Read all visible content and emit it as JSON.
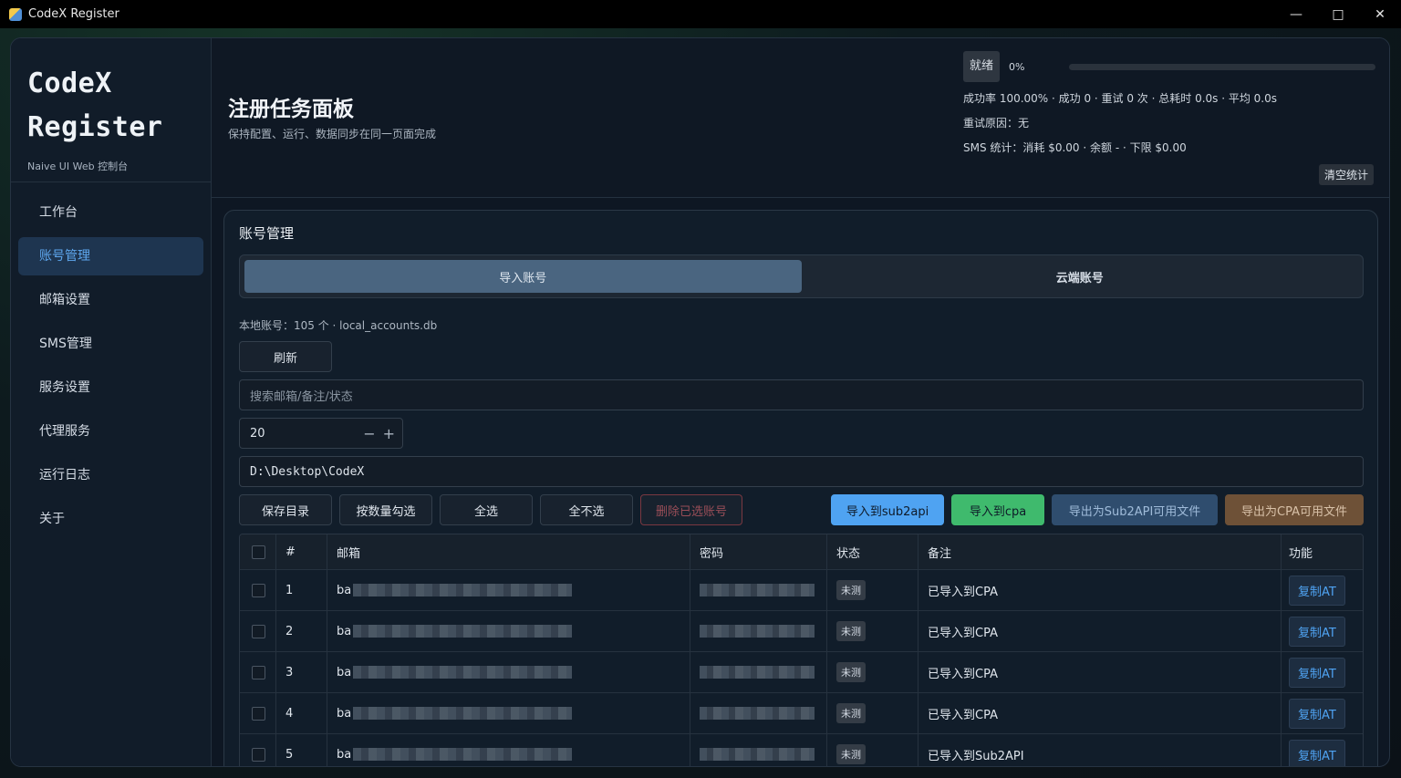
{
  "window": {
    "title": "CodeX Register"
  },
  "sidebar": {
    "brand_line1": "CodeX",
    "brand_line2": "Register",
    "brand_sub": "Naive UI Web 控制台",
    "items": [
      {
        "label": "工作台"
      },
      {
        "label": "账号管理"
      },
      {
        "label": "邮箱设置"
      },
      {
        "label": "SMS管理"
      },
      {
        "label": "服务设置"
      },
      {
        "label": "代理服务"
      },
      {
        "label": "运行日志"
      },
      {
        "label": "关于"
      }
    ]
  },
  "header": {
    "title": "注册任务面板",
    "subtitle": "保持配置、运行、数据同步在同一页面完成",
    "status_label": "就绪",
    "progress_percent": 0,
    "progress_text": "0%",
    "stats_line": "成功率 100.00% · 成功 0 · 重试 0 次 · 总耗时 0.0s · 平均 0.0s",
    "retry_reason": "重试原因：无",
    "sms_stats": "SMS 统计：消耗 $0.00 · 余额 - · 下限 $0.00",
    "clear_label": "清空统计"
  },
  "account": {
    "card_title": "账号管理",
    "tab_import": "导入账号",
    "tab_cloud": "云端账号",
    "local_info": "本地账号：105 个 · local_accounts.db",
    "refresh_label": "刷新",
    "search_placeholder": "搜索邮箱/备注/状态",
    "page_size": "20",
    "dir_path": "D:\\Desktop\\CodeX",
    "btn_save_dir": "保存目录",
    "btn_select_by_count": "按数量勾选",
    "btn_select_all": "全选",
    "btn_select_none": "全不选",
    "btn_delete_selected": "删除已选账号",
    "btn_import_sub2api": "导入到sub2api",
    "btn_import_cpa": "导入到cpa",
    "btn_export_sub2api": "导出为Sub2API可用文件",
    "btn_export_cpa": "导出为CPA可用文件"
  },
  "table": {
    "columns": {
      "idx": "#",
      "email": "邮箱",
      "password": "密码",
      "status": "状态",
      "note": "备注",
      "func": "功能"
    },
    "rows": [
      {
        "idx": "1",
        "email_prefix": "ba",
        "status": "未测",
        "note": "已导入到CPA",
        "action": "复制AT"
      },
      {
        "idx": "2",
        "email_prefix": "ba",
        "status": "未测",
        "note": "已导入到CPA",
        "action": "复制AT"
      },
      {
        "idx": "3",
        "email_prefix": "ba",
        "status": "未测",
        "note": "已导入到CPA",
        "action": "复制AT"
      },
      {
        "idx": "4",
        "email_prefix": "ba",
        "status": "未测",
        "note": "已导入到CPA",
        "action": "复制AT"
      },
      {
        "idx": "5",
        "email_prefix": "ba",
        "status": "未测",
        "note": "已导入到Sub2API",
        "action": "复制AT"
      }
    ]
  },
  "colors": {
    "accent": "#4fa3f2",
    "success": "#3fba6d",
    "steel": "#2f4d6e",
    "brown": "#6e5137",
    "danger": "#7a3841"
  }
}
